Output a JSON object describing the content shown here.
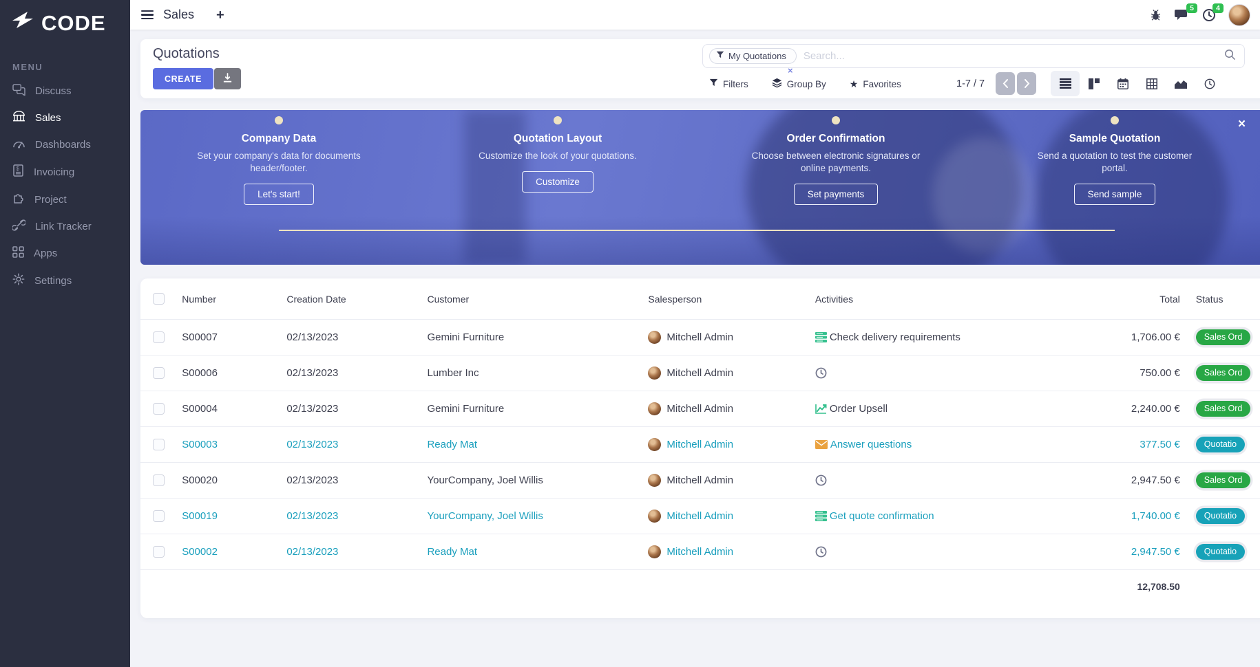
{
  "sidebar": {
    "logo": "CODE",
    "section_label": "MENU",
    "items": [
      {
        "id": "discuss",
        "label": "Discuss",
        "icon": "discuss-icon",
        "active": false
      },
      {
        "id": "sales",
        "label": "Sales",
        "icon": "sales-icon",
        "active": true
      },
      {
        "id": "dashboards",
        "label": "Dashboards",
        "icon": "dashboards-icon",
        "active": false
      },
      {
        "id": "invoicing",
        "label": "Invoicing",
        "icon": "invoicing-icon",
        "active": false
      },
      {
        "id": "project",
        "label": "Project",
        "icon": "project-icon",
        "active": false
      },
      {
        "id": "link-tracker",
        "label": "Link Tracker",
        "icon": "link-icon",
        "active": false
      },
      {
        "id": "apps",
        "label": "Apps",
        "icon": "apps-icon",
        "active": false
      },
      {
        "id": "settings",
        "label": "Settings",
        "icon": "settings-icon",
        "active": false
      }
    ]
  },
  "topbar": {
    "menu_title": "Sales",
    "new_tab": "+",
    "messages_badge": "5",
    "activities_badge": "4"
  },
  "control_panel": {
    "title": "Quotations",
    "create_label": "CREATE",
    "search": {
      "facet": "My Quotations",
      "placeholder": "Search...",
      "remove_facet": "×"
    },
    "filters_label": "Filters",
    "group_by_label": "Group By",
    "favorites_label": "Favorites",
    "pager_text": "1-7 / 7"
  },
  "banner": {
    "close": "×",
    "steps": [
      {
        "title": "Company Data",
        "description": "Set your company's data for documents header/footer.",
        "button": "Let's start!"
      },
      {
        "title": "Quotation Layout",
        "description": "Customize the look of your quotations.",
        "button": "Customize"
      },
      {
        "title": "Order Confirmation",
        "description": "Choose between electronic signatures or online payments.",
        "button": "Set payments"
      },
      {
        "title": "Sample Quotation",
        "description": "Send a quotation to test the customer portal.",
        "button": "Send sample"
      }
    ]
  },
  "table": {
    "columns": [
      "Number",
      "Creation Date",
      "Customer",
      "Salesperson",
      "Activities",
      "Total",
      "Status"
    ],
    "rows": [
      {
        "number": "S00007",
        "creation_date": "02/13/2023",
        "customer": "Gemini Furniture",
        "salesperson": "Mitchell Admin",
        "activity_label": "Check delivery requirements",
        "activity_icon": "activity-list-icon",
        "total": "1,706.00 €",
        "status_label": "Sales Ord",
        "status_kind": "sales-order",
        "highlighted": false
      },
      {
        "number": "S00006",
        "creation_date": "02/13/2023",
        "customer": "Lumber Inc",
        "salesperson": "Mitchell Admin",
        "activity_label": "",
        "activity_icon": "activity-clock-icon",
        "total": "750.00 €",
        "status_label": "Sales Ord",
        "status_kind": "sales-order",
        "highlighted": false
      },
      {
        "number": "S00004",
        "creation_date": "02/13/2023",
        "customer": "Gemini Furniture",
        "salesperson": "Mitchell Admin",
        "activity_label": "Order Upsell",
        "activity_icon": "activity-chart-icon",
        "total": "2,240.00 €",
        "status_label": "Sales Ord",
        "status_kind": "sales-order",
        "highlighted": false
      },
      {
        "number": "S00003",
        "creation_date": "02/13/2023",
        "customer": "Ready Mat",
        "salesperson": "Mitchell Admin",
        "activity_label": "Answer questions",
        "activity_icon": "activity-envelope-icon",
        "total": "377.50 €",
        "status_label": "Quotatio",
        "status_kind": "quotation",
        "highlighted": true
      },
      {
        "number": "S00020",
        "creation_date": "02/13/2023",
        "customer": "YourCompany, Joel Willis",
        "salesperson": "Mitchell Admin",
        "activity_label": "",
        "activity_icon": "activity-clock-icon",
        "total": "2,947.50 €",
        "status_label": "Sales Ord",
        "status_kind": "sales-order",
        "highlighted": false
      },
      {
        "number": "S00019",
        "creation_date": "02/13/2023",
        "customer": "YourCompany, Joel Willis",
        "salesperson": "Mitchell Admin",
        "activity_label": "Get quote confirmation",
        "activity_icon": "activity-list-icon",
        "total": "1,740.00 €",
        "status_label": "Quotatio",
        "status_kind": "quotation",
        "highlighted": true
      },
      {
        "number": "S00002",
        "creation_date": "02/13/2023",
        "customer": "Ready Mat",
        "salesperson": "Mitchell Admin",
        "activity_label": "",
        "activity_icon": "activity-clock-icon",
        "total": "2,947.50 €",
        "status_label": "Quotatio",
        "status_kind": "quotation",
        "highlighted": true
      }
    ],
    "footer_total": "12,708.50"
  },
  "colors": {
    "accent": "#5a6ce0",
    "sidebar_bg": "#2b2f40",
    "link_teal": "#1a9fbd",
    "status_green": "#28a745",
    "status_teal": "#17a2b8",
    "notification_green": "#2fbf51",
    "banner_dot": "#eee3c1"
  }
}
